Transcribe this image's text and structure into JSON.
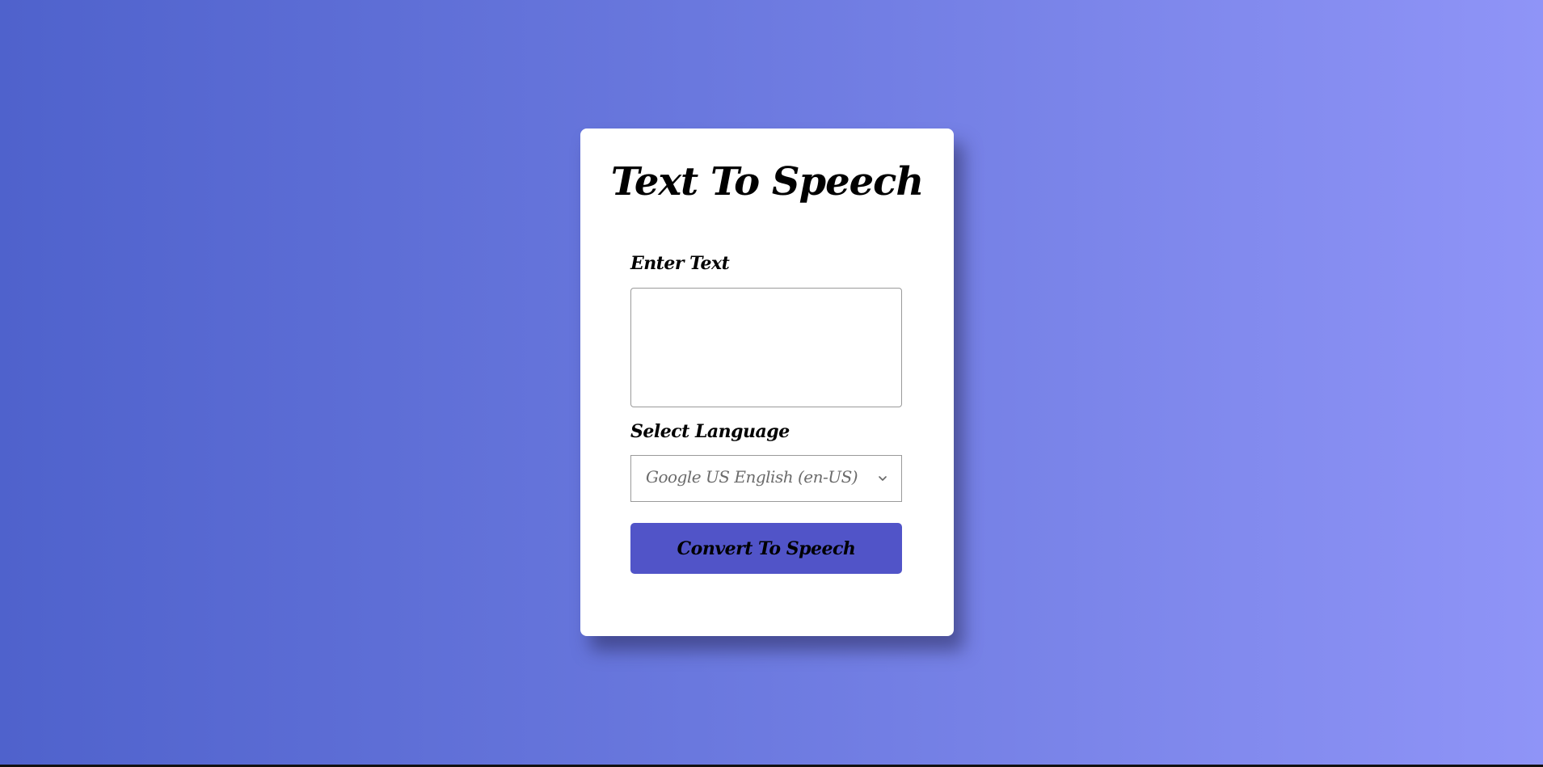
{
  "app": {
    "title": "Text To Speech"
  },
  "form": {
    "text_label": "Enter Text",
    "text_value": "",
    "language_label": "Select Language",
    "language_selected": "Google US English (en-US)",
    "language_chevron_icon": "chevron-down-icon",
    "submit_label": "Convert To Speech"
  },
  "colors": {
    "background_gradient_start": "#4f62cc",
    "background_gradient_end": "#8f94f7",
    "card": "#ffffff",
    "button": "#5154c8"
  }
}
